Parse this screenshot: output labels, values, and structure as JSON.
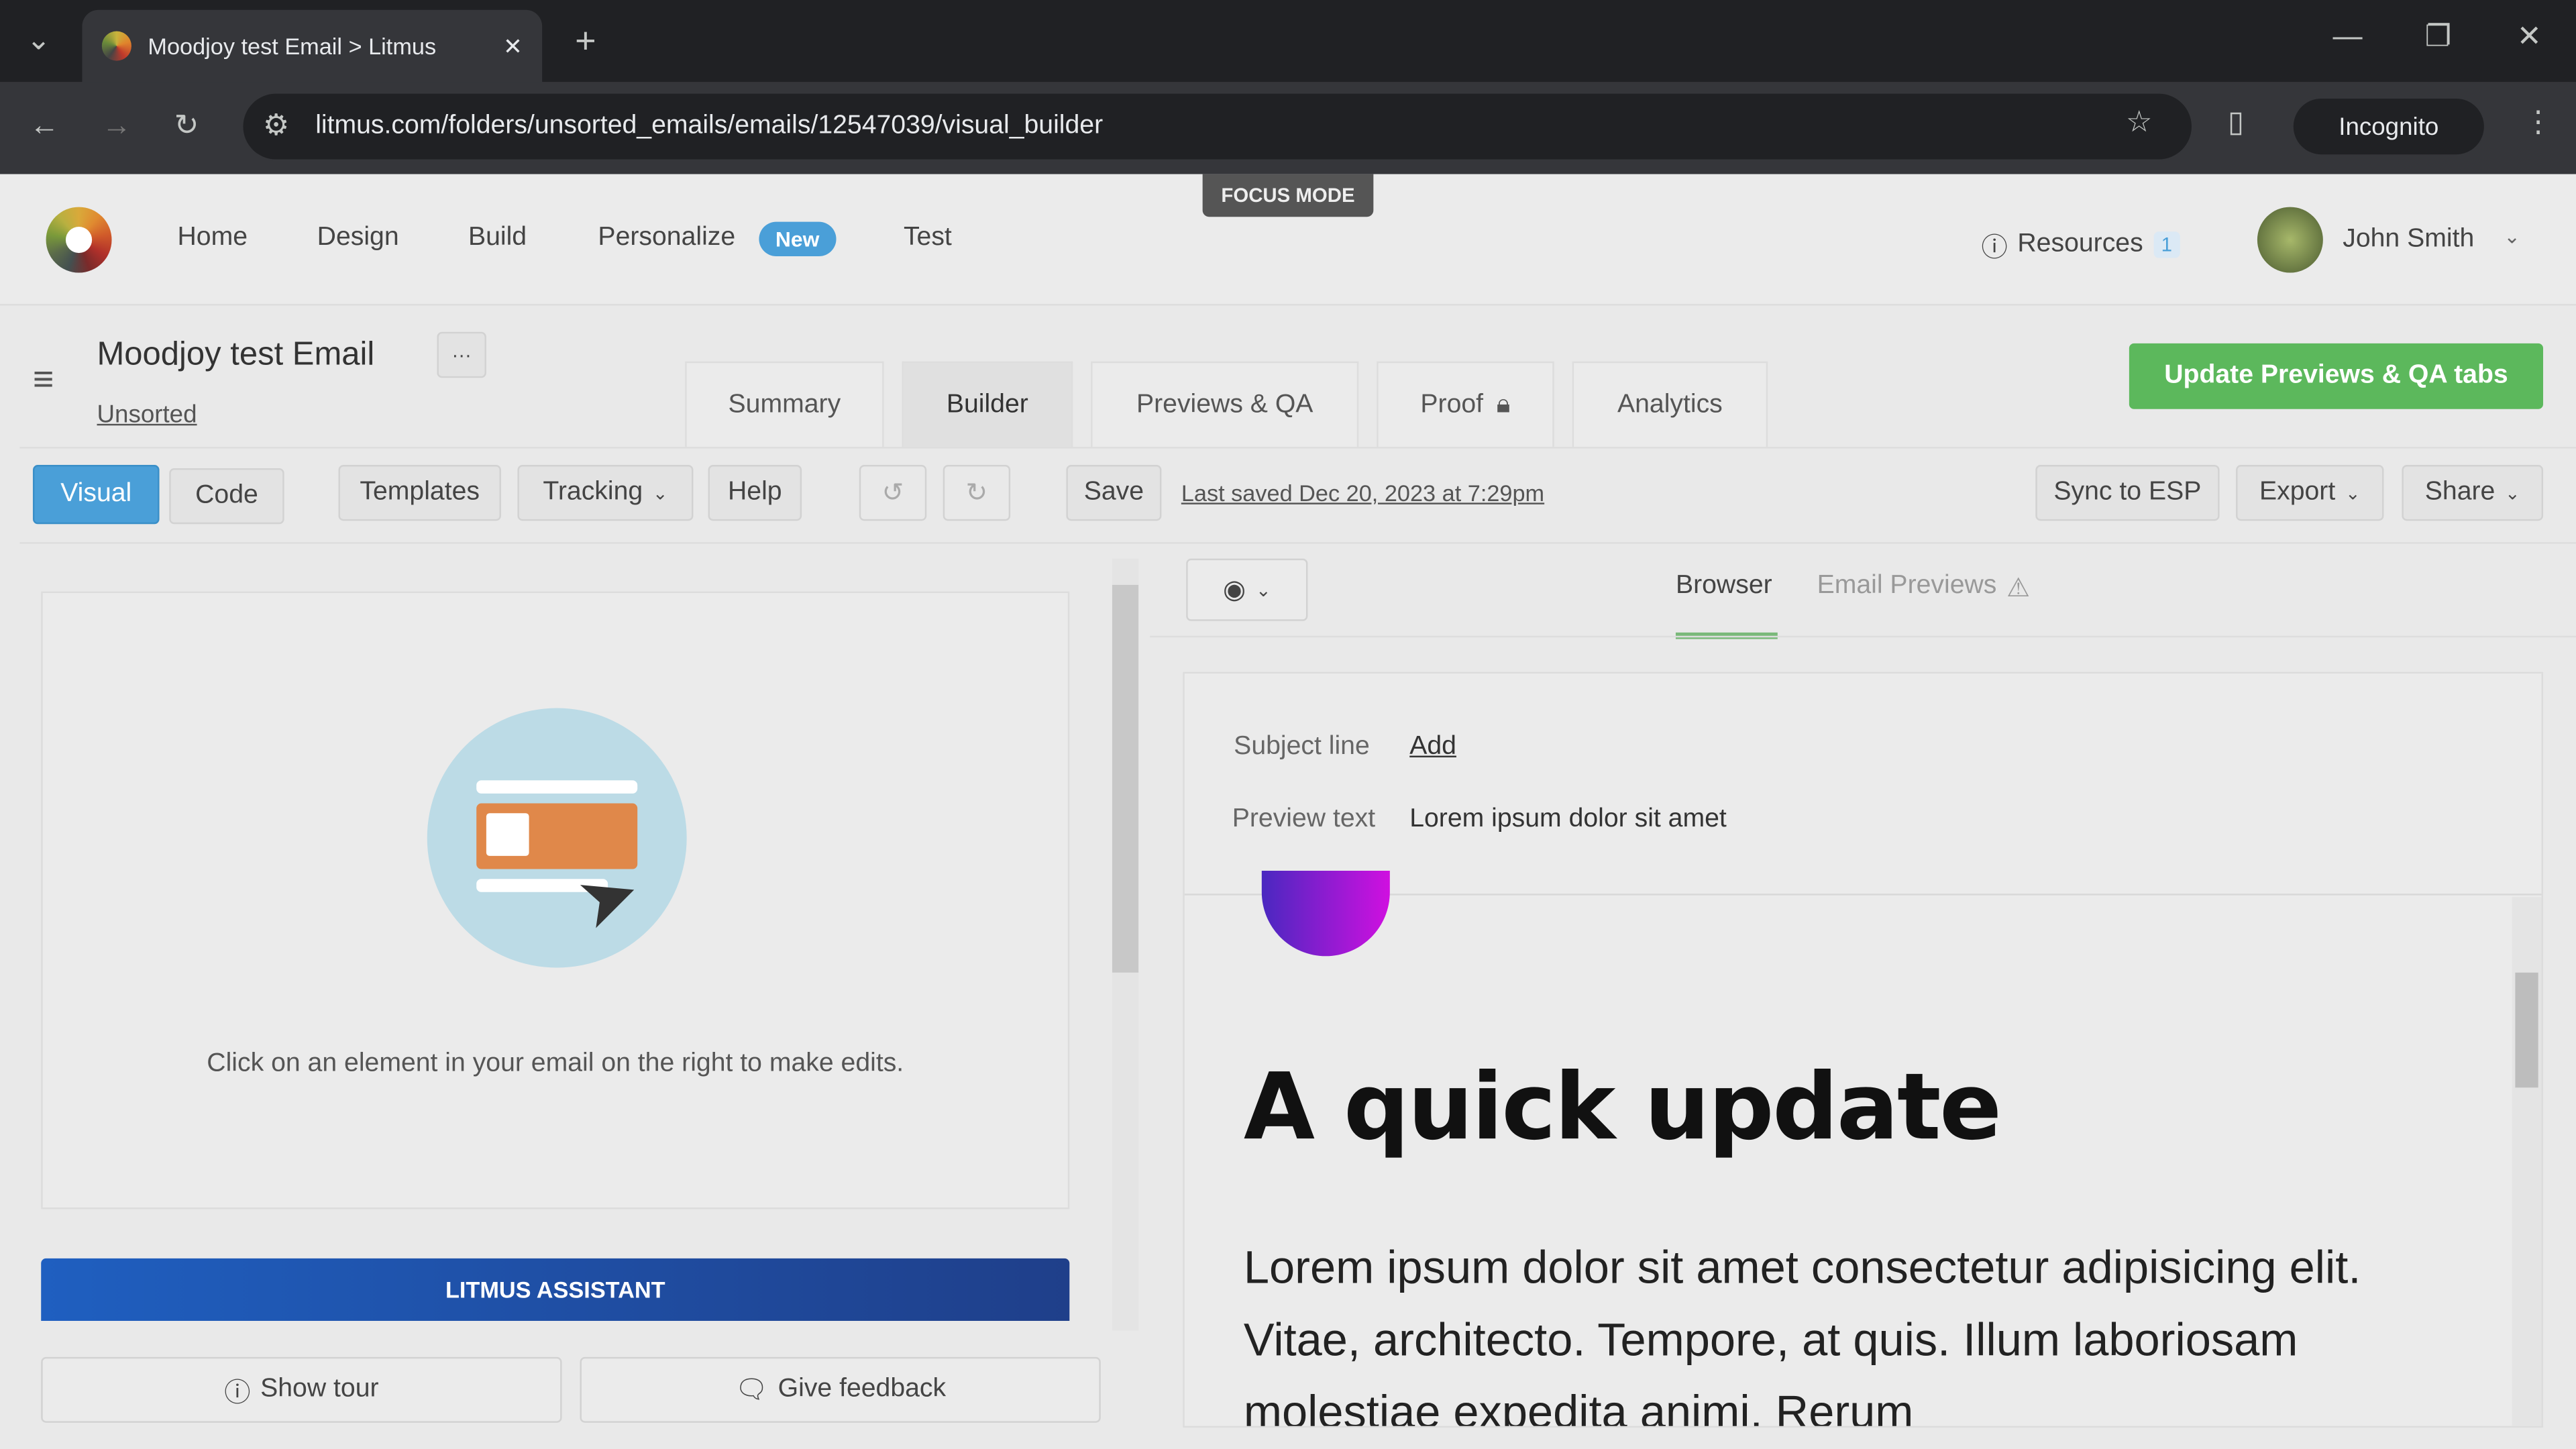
{
  "browser": {
    "tab_title": "Moodjoy test Email > Litmus",
    "url": "litmus.com/folders/unsorted_emails/emails/12547039/visual_builder",
    "incognito": "Incognito",
    "focus_mode": "FOCUS MODE"
  },
  "nav": {
    "items": [
      "Home",
      "Design",
      "Build",
      "Personalize",
      "Test"
    ],
    "new_badge": "New",
    "resources": "Resources",
    "resources_count": "1",
    "user": "John Smith"
  },
  "email": {
    "title": "Moodjoy test Email",
    "more": "···",
    "folder": "Unsorted"
  },
  "tabs": [
    "Summary",
    "Builder",
    "Previews & QA",
    "Proof",
    "Analytics"
  ],
  "update_button": "Update Previews & QA tabs",
  "toolbar": {
    "visual": "Visual",
    "code": "Code",
    "templates": "Templates",
    "tracking": "Tracking",
    "help": "Help",
    "save": "Save",
    "last_saved": "Last saved Dec 20, 2023 at 7:29pm",
    "sync": "Sync to ESP",
    "export": "Export",
    "share": "Share"
  },
  "left": {
    "hint": "Click on an element in your email on the right to make edits.",
    "assistant": "LITMUS ASSISTANT",
    "show_tour": "Show tour",
    "feedback": "Give feedback"
  },
  "preview": {
    "tab_browser": "Browser",
    "tab_email_previews": "Email Previews",
    "subject_label": "Subject line",
    "subject_value": "Add",
    "preview_label": "Preview text",
    "preview_value": "Lorem ipsum dolor sit amet",
    "heading": "A quick update",
    "body": "Lorem ipsum dolor sit amet consectetur adipisicing elit. Vitae, architecto. Tempore, at quis. Illum laboriosam molestiae expedita animi. Rerum"
  },
  "colors": {
    "accent_blue": "#4a9fd8",
    "green": "#5cb85c",
    "assistant_blue": "#1f4fa8"
  }
}
